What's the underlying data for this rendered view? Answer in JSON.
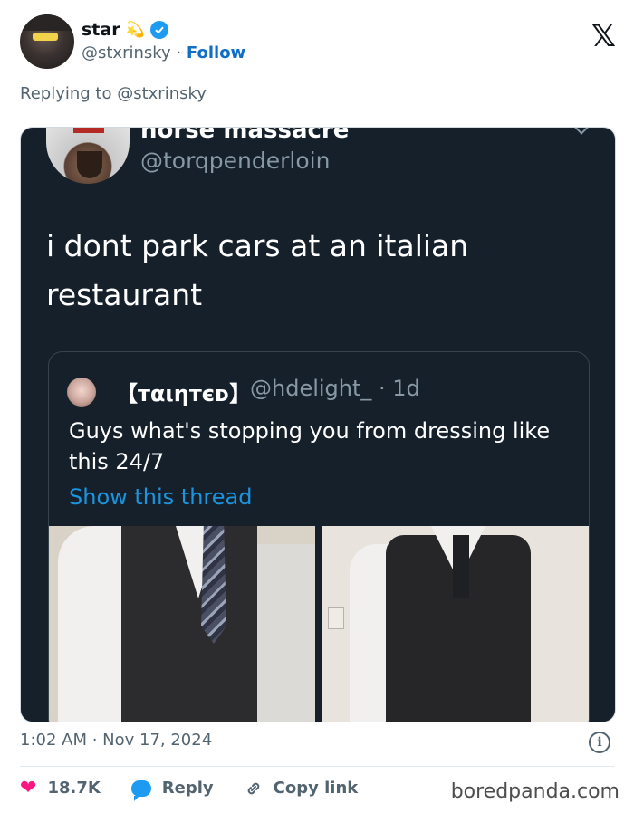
{
  "author": {
    "name": "star",
    "emoji": "💫",
    "handle": "@stxrinsky",
    "separator": "·",
    "follow_label": "Follow"
  },
  "brand": {
    "logo_text": "𝕏"
  },
  "replying": {
    "text": "Replying to @stxrinsky"
  },
  "embedded_tweet": {
    "name": "horse massacre",
    "handle": "@torqpenderloin",
    "text": "i dont park cars at an italian restaurant",
    "quote": {
      "name": "【тαιηтєᴅ】",
      "meta": "@hdelight_ · 1d",
      "text": "Guys what's stopping you from dressing like this 24/7",
      "link": "Show this thread"
    }
  },
  "timestamp": "1:02 AM · Nov 17, 2024",
  "actions": {
    "likes": "18.7K",
    "reply": "Reply",
    "copy_link": "Copy link"
  },
  "watermark": "boredpanda.com",
  "colors": {
    "accent": "#1d9bf0",
    "follow": "#0f6fc6",
    "like": "#f91880",
    "embed_bg": "#15202b"
  }
}
